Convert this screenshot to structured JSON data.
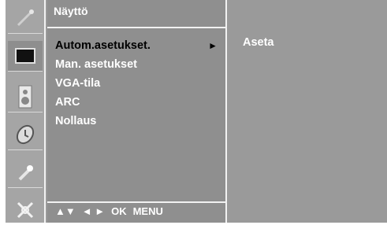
{
  "menu": {
    "title": "Näyttö",
    "items": [
      {
        "label": "Autom.asetukset.",
        "selected": true,
        "arrow": "►"
      },
      {
        "label": "Man. asetukset",
        "selected": false
      },
      {
        "label": "VGA-tila",
        "selected": false
      },
      {
        "label": "ARC",
        "selected": false
      },
      {
        "label": "Nollaus",
        "selected": false
      }
    ]
  },
  "submenu": {
    "items": [
      {
        "label": "Aseta"
      }
    ]
  },
  "nav": {
    "up_down": "▲▼",
    "left_right": "◄ ►",
    "ok": "OK",
    "menu": "MENU"
  },
  "icons": [
    {
      "name": "picture-wand-icon"
    },
    {
      "name": "screen-icon",
      "active": true
    },
    {
      "name": "speaker-icon"
    },
    {
      "name": "clock-icon"
    },
    {
      "name": "key-icon"
    },
    {
      "name": "setup-icon"
    }
  ],
  "colors": {
    "panel": "#8f8f8f",
    "background": "#9a9a9a",
    "text": "#ffffff",
    "selected_text": "#000000"
  }
}
